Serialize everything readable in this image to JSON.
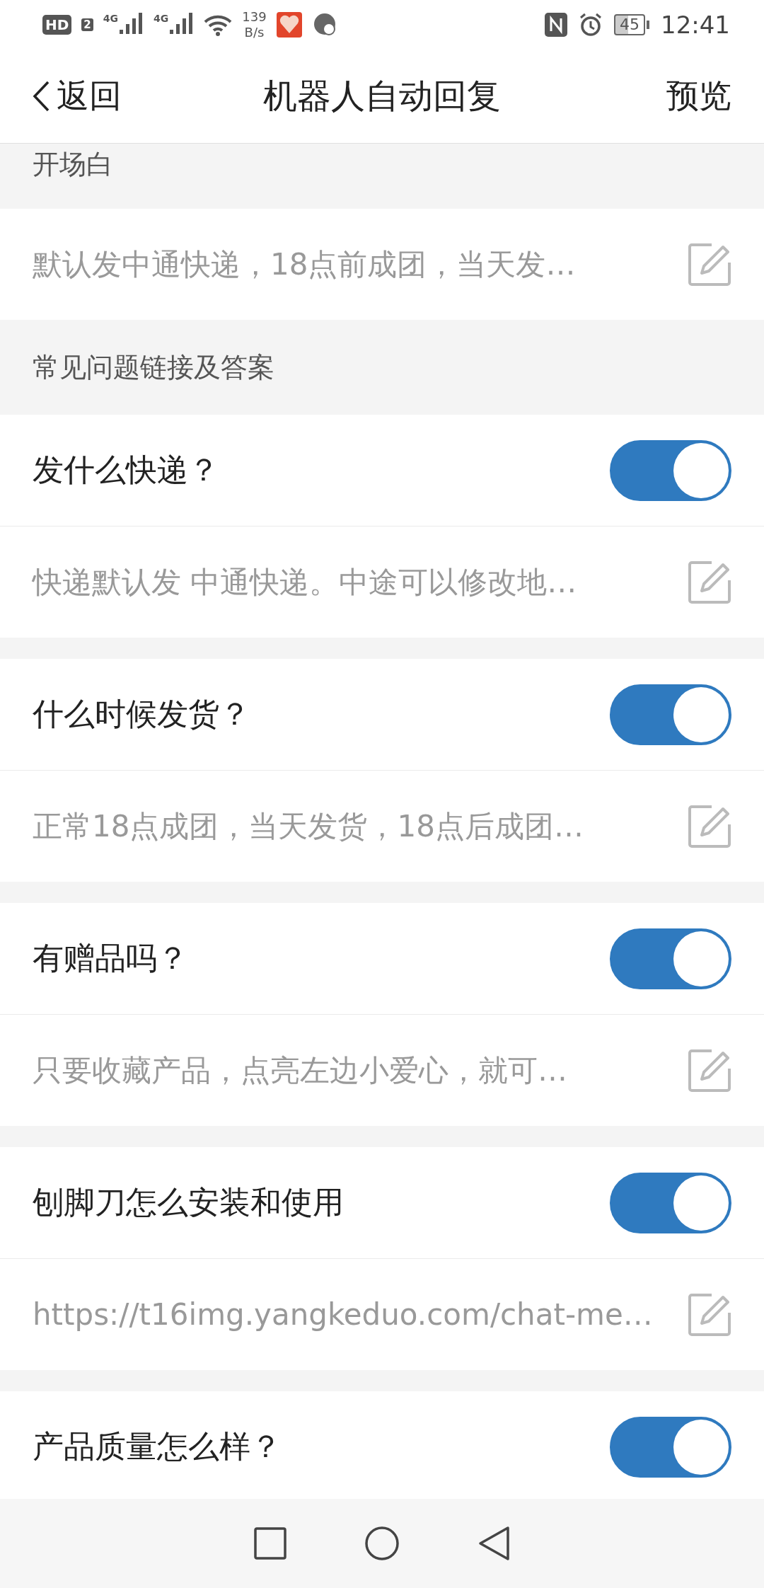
{
  "status_bar": {
    "network_badge": "HD",
    "sim_slot": "2",
    "signal_1": "4G",
    "signal_2": "4G",
    "speed_value": "139",
    "speed_unit": "B/s",
    "battery": "45",
    "time": "12:41"
  },
  "nav": {
    "back": "返回",
    "title": "机器人自动回复",
    "action": "预览"
  },
  "greeting": {
    "header": "开场白",
    "text": "默认发中通快递，18点前成团，当天发…"
  },
  "faq": {
    "header": "常见问题链接及答案",
    "items": [
      {
        "question": "发什么快递？",
        "on": true,
        "answer": "快递默认发 中通快递。中途可以修改地…"
      },
      {
        "question": "什么时候发货？",
        "on": true,
        "answer": "正常18点成团，当天发货，18点后成团…"
      },
      {
        "question": "有赠品吗？",
        "on": true,
        "answer": "只要收藏产品，点亮左边小爱心，就可…"
      },
      {
        "question": "刨脚刀怎么安装和使用",
        "on": true,
        "answer": "https://t16img.yangkeduo.com/chat-me…"
      },
      {
        "question": "产品质量怎么样？",
        "on": true
      }
    ]
  }
}
